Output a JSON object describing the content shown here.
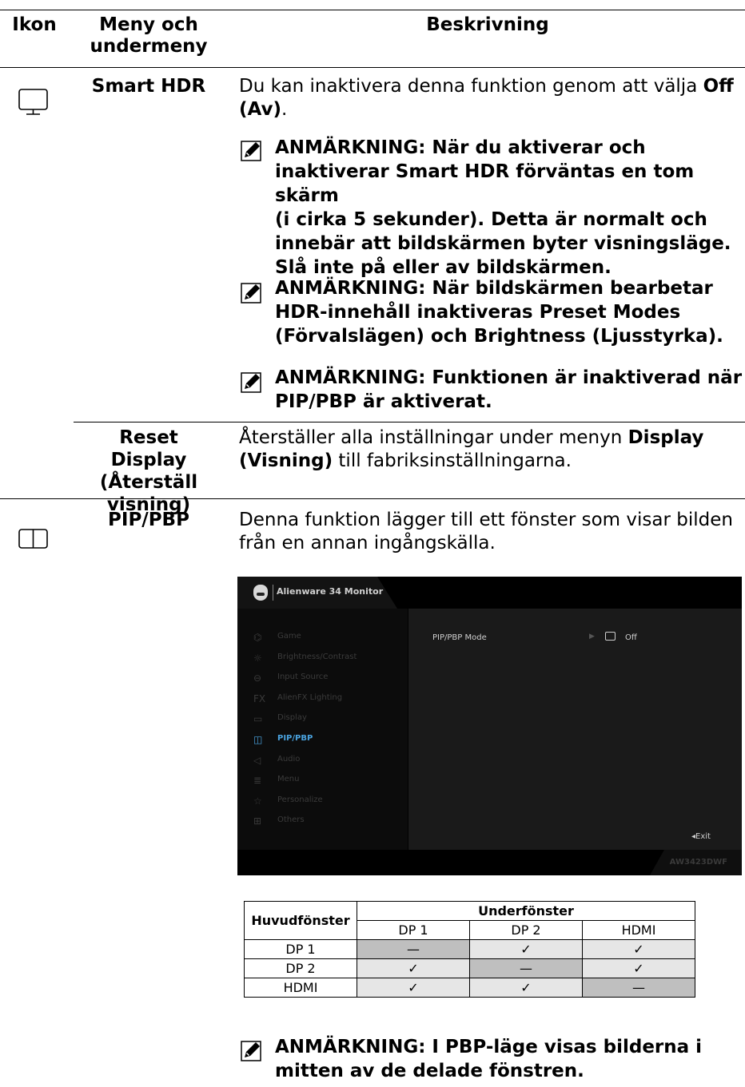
{
  "header": {
    "col_icon": "Ikon",
    "col_menu_line1": "Meny och",
    "col_menu_line2": "undermeny",
    "col_desc": "Beskrivning"
  },
  "rows": {
    "smart_hdr": {
      "name": "Smart HDR",
      "desc_pre": "Du kan inaktivera denna funktion genom att välja ",
      "desc_bold": "Off (Av)",
      "desc_post": ".",
      "notes": [
        [
          "ANMÄRKNING: När du aktiverar och",
          "inaktiverar Smart HDR förväntas en tom skärm",
          "(i cirka 5 sekunder). Detta är normalt och",
          "innebär att bildskärmen byter visningsläge.",
          "Slå inte på eller av bildskärmen."
        ],
        [
          "ANMÄRKNING: När bildskärmen bearbetar",
          "HDR-innehåll inaktiveras Preset Modes",
          "(Förvalslägen) och Brightness (Ljusstyrka)."
        ],
        [
          "ANMÄRKNING: Funktionen är inaktiverad när",
          "PIP/PBP är aktiverat."
        ]
      ]
    },
    "reset_display": {
      "name_line1": "Reset Display",
      "name_line2": "(Återställ",
      "name_line3": "visning)",
      "desc_pre": "Återställer alla inställningar under menyn ",
      "desc_bold1": "Display",
      "desc_bold2": "(Visning)",
      "desc_post": " till fabriksinställningarna."
    },
    "pip_pbp": {
      "name": "PIP/PBP",
      "desc_line1": "Denna funktion lägger till ett fönster som visar bilden",
      "desc_line2": "från en annan ingångskälla.",
      "final_note": [
        "ANMÄRKNING: I PBP-läge visas bilderna i",
        "mitten av de delade fönstren."
      ]
    }
  },
  "osd": {
    "brand": "Alienware 34 Monitor",
    "menu_items": [
      {
        "icon": "gamepad-icon",
        "glyph": "⌬",
        "label": "Game"
      },
      {
        "icon": "brightness-icon",
        "glyph": "☼",
        "label": "Brightness/Contrast"
      },
      {
        "icon": "input-source-icon",
        "glyph": "⊖",
        "label": "Input Source"
      },
      {
        "icon": "alienfx-icon",
        "glyph": "FX",
        "label": "AlienFX Lighting"
      },
      {
        "icon": "display-icon",
        "glyph": "▭",
        "label": "Display"
      },
      {
        "icon": "pip-pbp-icon",
        "glyph": "◫",
        "label": "PIP/PBP"
      },
      {
        "icon": "audio-icon",
        "glyph": "◁",
        "label": "Audio"
      },
      {
        "icon": "menu-icon",
        "glyph": "≣",
        "label": "Menu"
      },
      {
        "icon": "star-icon",
        "glyph": "☆",
        "label": "Personalize"
      },
      {
        "icon": "others-icon",
        "glyph": "⊞",
        "label": "Others"
      }
    ],
    "active_index": 5,
    "option_label": "PIP/PBP Mode",
    "option_value": "Off",
    "exit_label": "◂Exit",
    "model": "AW3423DWF"
  },
  "compat_table": {
    "row_header": "Huvudfönster",
    "col_group": "Underfönster",
    "columns": [
      "DP 1",
      "DP 2",
      "HDMI"
    ],
    "rows": [
      {
        "label": "DP 1",
        "cells": [
          "—",
          "✓",
          "✓"
        ]
      },
      {
        "label": "DP 2",
        "cells": [
          "✓",
          "—",
          "✓"
        ]
      },
      {
        "label": "HDMI",
        "cells": [
          "✓",
          "✓",
          "—"
        ]
      }
    ]
  }
}
